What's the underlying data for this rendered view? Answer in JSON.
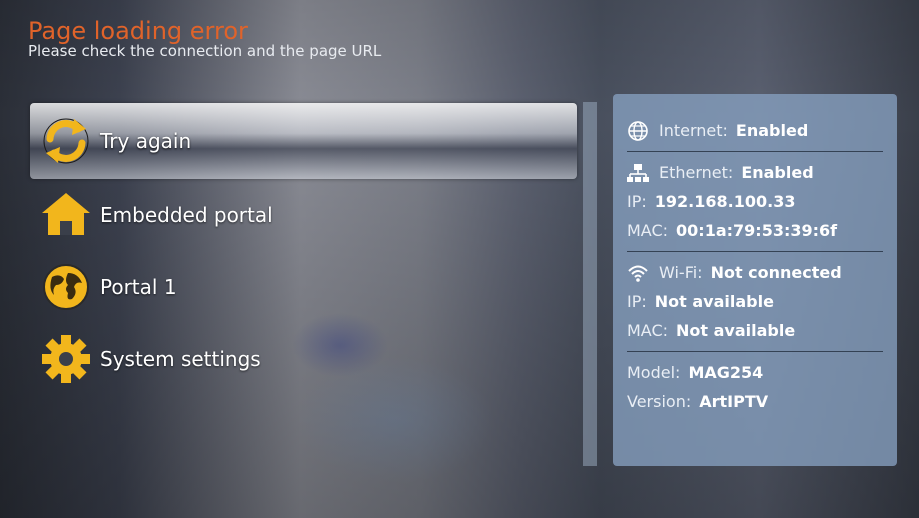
{
  "header": {
    "title": "Page loading error",
    "subtitle": "Please check the connection and the page URL"
  },
  "menu": {
    "items": [
      {
        "label": "Try again",
        "icon": "refresh-icon",
        "selected": true
      },
      {
        "label": "Embedded portal",
        "icon": "home-icon",
        "selected": false
      },
      {
        "label": "Portal 1",
        "icon": "globe-icon",
        "selected": false
      },
      {
        "label": "System settings",
        "icon": "gear-icon",
        "selected": false
      }
    ]
  },
  "status": {
    "internet": {
      "label": "Internet:",
      "value": "Enabled",
      "icon": "globe-icon"
    },
    "ethernet": {
      "label": "Ethernet:",
      "value": "Enabled",
      "icon": "network-icon",
      "ip_label": "IP:",
      "ip": "192.168.100.33",
      "mac_label": "MAC:",
      "mac": "00:1a:79:53:39:6f"
    },
    "wifi": {
      "label": "Wi-Fi:",
      "value": "Not connected",
      "icon": "wifi-icon",
      "ip_label": "IP:",
      "ip": "Not available",
      "mac_label": "MAC:",
      "mac": "Not available"
    },
    "device": {
      "model_label": "Model:",
      "model": "MAG254",
      "version_label": "Version:",
      "version": "ArtIPTV"
    }
  },
  "colors": {
    "title": "#e0632a",
    "icon_gold": "#f2b61c",
    "panel_bg": "#87a0c0"
  }
}
